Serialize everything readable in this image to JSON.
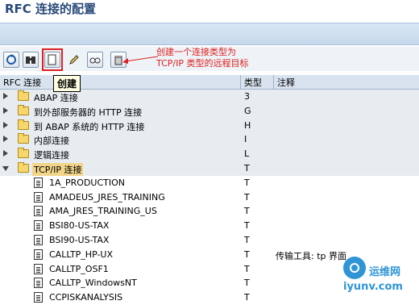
{
  "window": {
    "title": "RFC 连接的配置"
  },
  "toolbar": {
    "buttons": [
      {
        "icon": "refresh-icon"
      },
      {
        "icon": "binoculars-icon"
      },
      {
        "icon": "create-icon"
      },
      {
        "icon": "pencil-icon"
      },
      {
        "icon": "glasses-icon"
      },
      {
        "icon": "trash-icon"
      }
    ],
    "tooltip": "创建",
    "callout_line1": "创建一个连接类型为",
    "callout_line2": "TCP/IP 类型的远程目标"
  },
  "columns": {
    "name": "RFC 连接",
    "type": "类型",
    "note": "注释"
  },
  "groups": [
    {
      "label": "ABAP 连接",
      "type": "3"
    },
    {
      "label": "到外部服务器的 HTTP 连接",
      "type": "G"
    },
    {
      "label": "到 ABAP 系统的 HTTP 连接",
      "type": "H"
    },
    {
      "label": "内部连接",
      "type": "I"
    },
    {
      "label": "逻辑连接",
      "type": "L"
    },
    {
      "label": "TCP/IP 连接",
      "type": "T"
    }
  ],
  "tcp_connections": [
    {
      "name": "1A_PRODUCTION",
      "type": "T",
      "note": ""
    },
    {
      "name": "AMADEUS_JRES_TRAINING",
      "type": "T",
      "note": ""
    },
    {
      "name": "AMA_JRES_TRAINING_US",
      "type": "T",
      "note": ""
    },
    {
      "name": "BSI80-US-TAX",
      "type": "T",
      "note": ""
    },
    {
      "name": "BSI90-US-TAX",
      "type": "T",
      "note": ""
    },
    {
      "name": "CALLTP_HP-UX",
      "type": "T",
      "note": "传输工具: tp 界面"
    },
    {
      "name": "CALLTP_OSF1",
      "type": "T",
      "note": ""
    },
    {
      "name": "CALLTP_WindowsNT",
      "type": "T",
      "note": ""
    },
    {
      "name": "CCPISKANALYSIS",
      "type": "T",
      "note": ""
    }
  ],
  "watermark": {
    "cn": "运维网",
    "en": "iyunv.com"
  },
  "colors": {
    "title": "#2a4a7a",
    "highlight": "#e02020",
    "selected": "#f3d58a",
    "group_bg": "#e7ecf1"
  }
}
